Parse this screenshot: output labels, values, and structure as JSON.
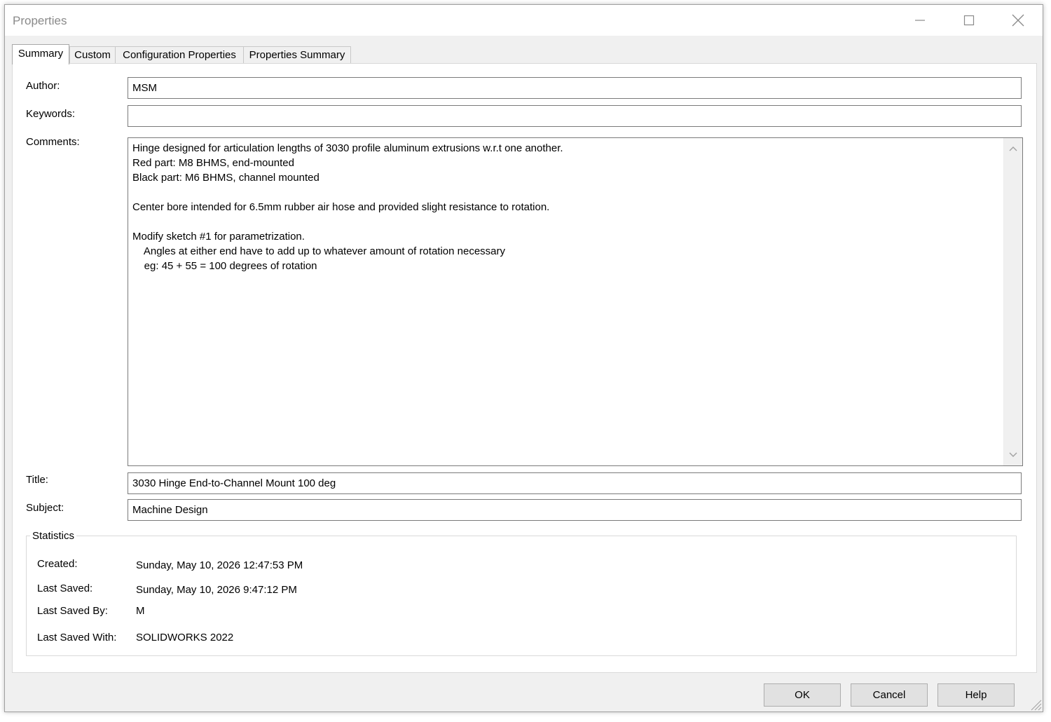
{
  "window": {
    "title": "Properties"
  },
  "window_controls": {
    "minimize": "minimize-icon",
    "maximize": "maximize-icon",
    "close": "close-icon"
  },
  "tabs": [
    {
      "label": "Summary",
      "active": true
    },
    {
      "label": "Custom",
      "active": false
    },
    {
      "label": "Configuration Properties",
      "active": false
    },
    {
      "label": "Properties Summary",
      "active": false
    }
  ],
  "summary": {
    "author_label": "Author:",
    "author_value": "MSM",
    "keywords_label": "Keywords:",
    "keywords_value": "",
    "comments_label": "Comments:",
    "comments_value": "Hinge designed for articulation lengths of 3030 profile aluminum extrusions w.r.t one another.\nRed part: M8 BHMS, end-mounted\nBlack part: M6 BHMS, channel mounted\n\nCenter bore intended for 6.5mm rubber air hose and provided slight resistance to rotation.\n\nModify sketch #1 for parametrization.\n    Angles at either end have to add up to whatever amount of rotation necessary\n    eg: 45 + 55 = 100 degrees of rotation",
    "title_label": "Title:",
    "title_value": "3030 Hinge End-to-Channel Mount 100 deg",
    "subject_label": "Subject:",
    "subject_value": "Machine Design"
  },
  "statistics": {
    "caption": "Statistics",
    "created_label": "Created:",
    "created_value": "Sunday, May 10, 2026 12:47:53 PM",
    "last_saved_label": "Last Saved:",
    "last_saved_value": "Sunday, May 10, 2026 9:47:12 PM",
    "last_saved_by_label": "Last Saved By:",
    "last_saved_by_value": "M",
    "last_saved_with_label": "Last Saved With:",
    "last_saved_with_value": "SOLIDWORKS 2022"
  },
  "buttons": {
    "ok": "OK",
    "cancel": "Cancel",
    "help": "Help"
  }
}
